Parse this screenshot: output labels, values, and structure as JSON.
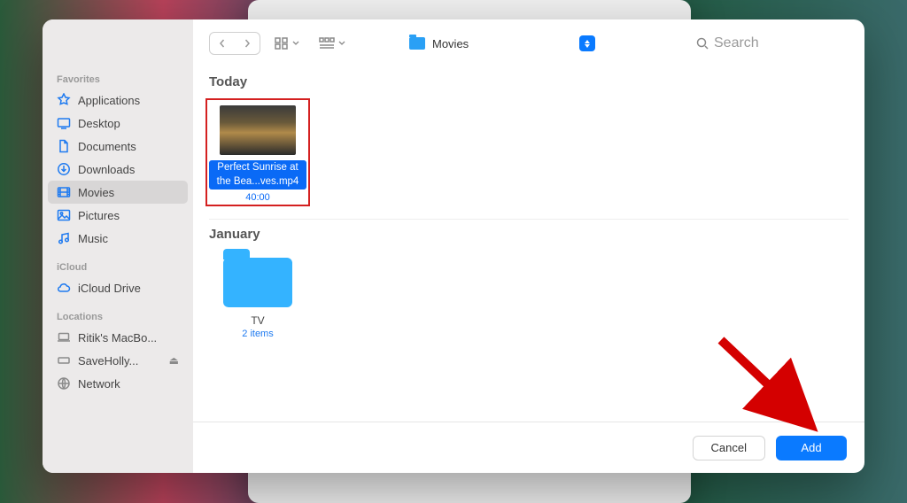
{
  "sidebar": {
    "favorites_label": "Favorites",
    "icloud_label": "iCloud",
    "locations_label": "Locations",
    "items": [
      {
        "label": "Applications"
      },
      {
        "label": "Desktop"
      },
      {
        "label": "Documents"
      },
      {
        "label": "Downloads"
      },
      {
        "label": "Movies"
      },
      {
        "label": "Pictures"
      },
      {
        "label": "Music"
      }
    ],
    "icloud_items": [
      {
        "label": "iCloud Drive"
      }
    ],
    "location_items": [
      {
        "label": "Ritik's MacBo..."
      },
      {
        "label": "SaveHolly..."
      },
      {
        "label": "Network"
      }
    ]
  },
  "toolbar": {
    "location": "Movies",
    "search_placeholder": "Search"
  },
  "content": {
    "sections": [
      {
        "heading": "Today",
        "file": {
          "name": "Perfect Sunrise at the Bea...ves.mp4",
          "duration": "40:00",
          "selected": true
        }
      },
      {
        "heading": "January",
        "folder": {
          "name": "TV",
          "meta": "2 items"
        }
      }
    ]
  },
  "footer": {
    "cancel": "Cancel",
    "confirm": "Add"
  }
}
